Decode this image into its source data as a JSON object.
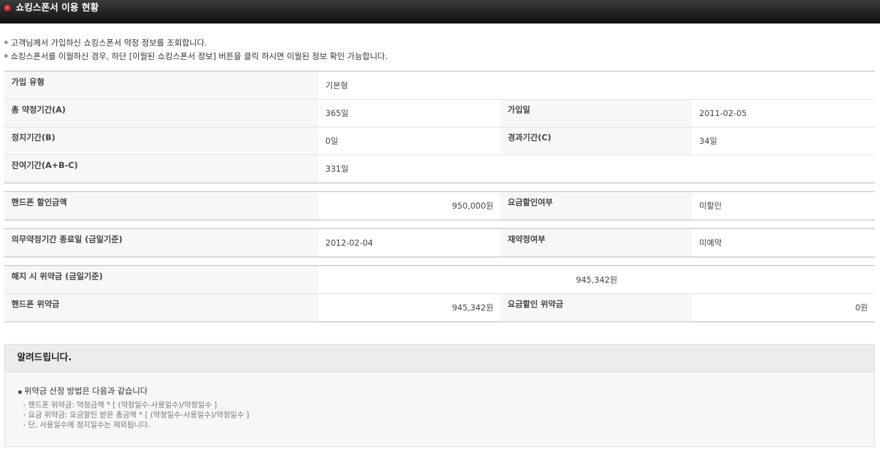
{
  "header": {
    "title": "쇼킹스폰서 이용 현황"
  },
  "notes": [
    "고객님께서 가입하신 쇼킹스폰서 약정 정보를 조회합니다.",
    "쇼킹스폰서를 이월하신 경우, 하단 [이월된 쇼킹스폰서 정보] 버튼을 클릭 하시면 이월된 정보 확인 가능합니다."
  ],
  "table1": {
    "join_type_label": "가입 유형",
    "join_type_value": "기본형",
    "total_period_label": "총 약정기간(A)",
    "total_period_value": "365일",
    "join_date_label": "가입일",
    "join_date_value": "2011-02-05",
    "stop_period_label": "정지기간(B)",
    "stop_period_value": "0일",
    "elapsed_label": "경과기간(C)",
    "elapsed_value": "34일",
    "remain_label": "잔여기간(A+B-C)",
    "remain_value": "331일"
  },
  "table2": {
    "phone_discount_label": "핸드폰 할인금액",
    "phone_discount_value": "950,000원",
    "fee_discount_label": "요금할인여부",
    "fee_discount_value": "미할인"
  },
  "table3": {
    "end_date_label": "의무약정기간 종료일 (금일기준)",
    "end_date_value": "2012-02-04",
    "recontract_label": "재약정여부",
    "recontract_value": "미예약"
  },
  "table4": {
    "penalty_label": "해지 시 위약금 (금일기준)",
    "penalty_value": "945,342원",
    "phone_penalty_label": "핸드폰 위약금",
    "phone_penalty_value": "945,342원",
    "fee_penalty_label": "요금할인 위약금",
    "fee_penalty_value": "0원"
  },
  "notice": {
    "title": "알려드립니다.",
    "main": "위약금 산정 방법은 다음과 같습니다",
    "lines": [
      "핸드폰 위약금: 약정금액 * [ (약정일수-사용일수)/약정일수 ]",
      "요금 위약금: 요금할인 받은 총금액 * [ (약정일수-사용일수)/약정일수 ]",
      "단, 사용일수에 정지일수는 제외됩니다."
    ]
  }
}
